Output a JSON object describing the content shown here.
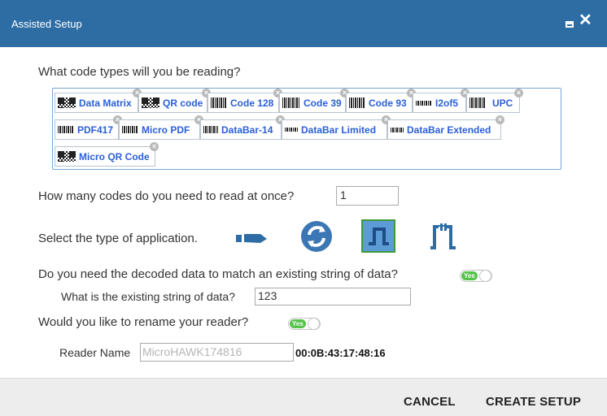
{
  "window": {
    "title": "Assisted Setup"
  },
  "code_types": {
    "question": "What code types will you be reading?",
    "tags": [
      "Data Matrix",
      "QR code",
      "Code 128",
      "Code 39",
      "Code 93",
      "I2of5",
      "UPC",
      "PDF417",
      "Micro PDF",
      "DataBar-14",
      "DataBar Limited",
      "DataBar Extended",
      "Micro QR Code"
    ]
  },
  "count": {
    "question": "How many codes do you need to read at once?",
    "value": "1"
  },
  "application": {
    "question": "Select the type of application."
  },
  "match": {
    "question": "Do you need the decoded data to match an existing string of data?",
    "toggle": "Yes",
    "string_question": "What is the existing string of data?",
    "string_value": "123"
  },
  "rename": {
    "question": "Would you like to rename your reader?",
    "toggle": "Yes",
    "name_label": "Reader Name",
    "name_placeholder": "MicroHAWK174816",
    "mac": "00:0B:43:17:48:16"
  },
  "footer": {
    "cancel": "CANCEL",
    "create": "CREATE SETUP"
  }
}
